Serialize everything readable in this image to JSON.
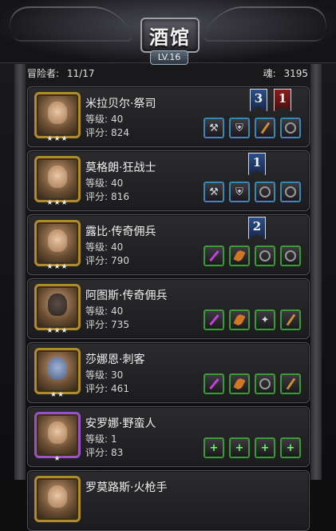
{
  "header": {
    "title": "酒馆",
    "level": "LV.16"
  },
  "status": {
    "adventurers_label": "冒险者:",
    "adventurers_value": "11/17",
    "soul_label": "魂:",
    "soul_value": "3195"
  },
  "level_label": "等级:",
  "score_label": "评分:",
  "cards": [
    {
      "name": "米拉贝尔·祭司",
      "level": "40",
      "score": "824",
      "stars": "★★★",
      "ranks": [
        {
          "text": "3",
          "color": "blue"
        },
        {
          "text": "1",
          "color": "red"
        }
      ],
      "slots": [
        "axe-icon",
        "armor-icon",
        "staff-icon",
        "ring-icon"
      ]
    },
    {
      "name": "莫格朗·狂战士",
      "level": "40",
      "score": "816",
      "stars": "★★★",
      "ranks": [
        {
          "text": "1",
          "color": "blue"
        }
      ],
      "slots": [
        "axe-icon",
        "armor-icon",
        "ring-icon",
        "ring-icon"
      ]
    },
    {
      "name": "露比·传奇佣兵",
      "level": "40",
      "score": "790",
      "stars": "★★★",
      "ranks": [
        {
          "text": "2",
          "color": "blue"
        }
      ],
      "slots": [
        "blade-icon",
        "leaf-icon",
        "ring-icon",
        "ring-icon"
      ]
    },
    {
      "name": "阿图斯·传奇佣兵",
      "level": "40",
      "score": "735",
      "stars": "★★★",
      "ranks": [],
      "slots": [
        "blade-icon",
        "leaf-icon",
        "gem-icon",
        "staff-icon"
      ]
    },
    {
      "name": "莎娜恩·刺客",
      "level": "30",
      "score": "461",
      "stars": "★★",
      "ranks": [],
      "slots": [
        "blade-icon",
        "leaf-icon",
        "ring-icon",
        "staff-icon"
      ]
    },
    {
      "name": "安罗娜·野蛮人",
      "level": "1",
      "score": "83",
      "stars": "★",
      "ranks": [],
      "slots": [
        "plus-icon",
        "plus-icon",
        "plus-icon",
        "plus-icon"
      ]
    },
    {
      "name": "罗莫路斯·火枪手",
      "level": "",
      "score": "",
      "stars": "",
      "ranks": [],
      "slots": []
    }
  ]
}
